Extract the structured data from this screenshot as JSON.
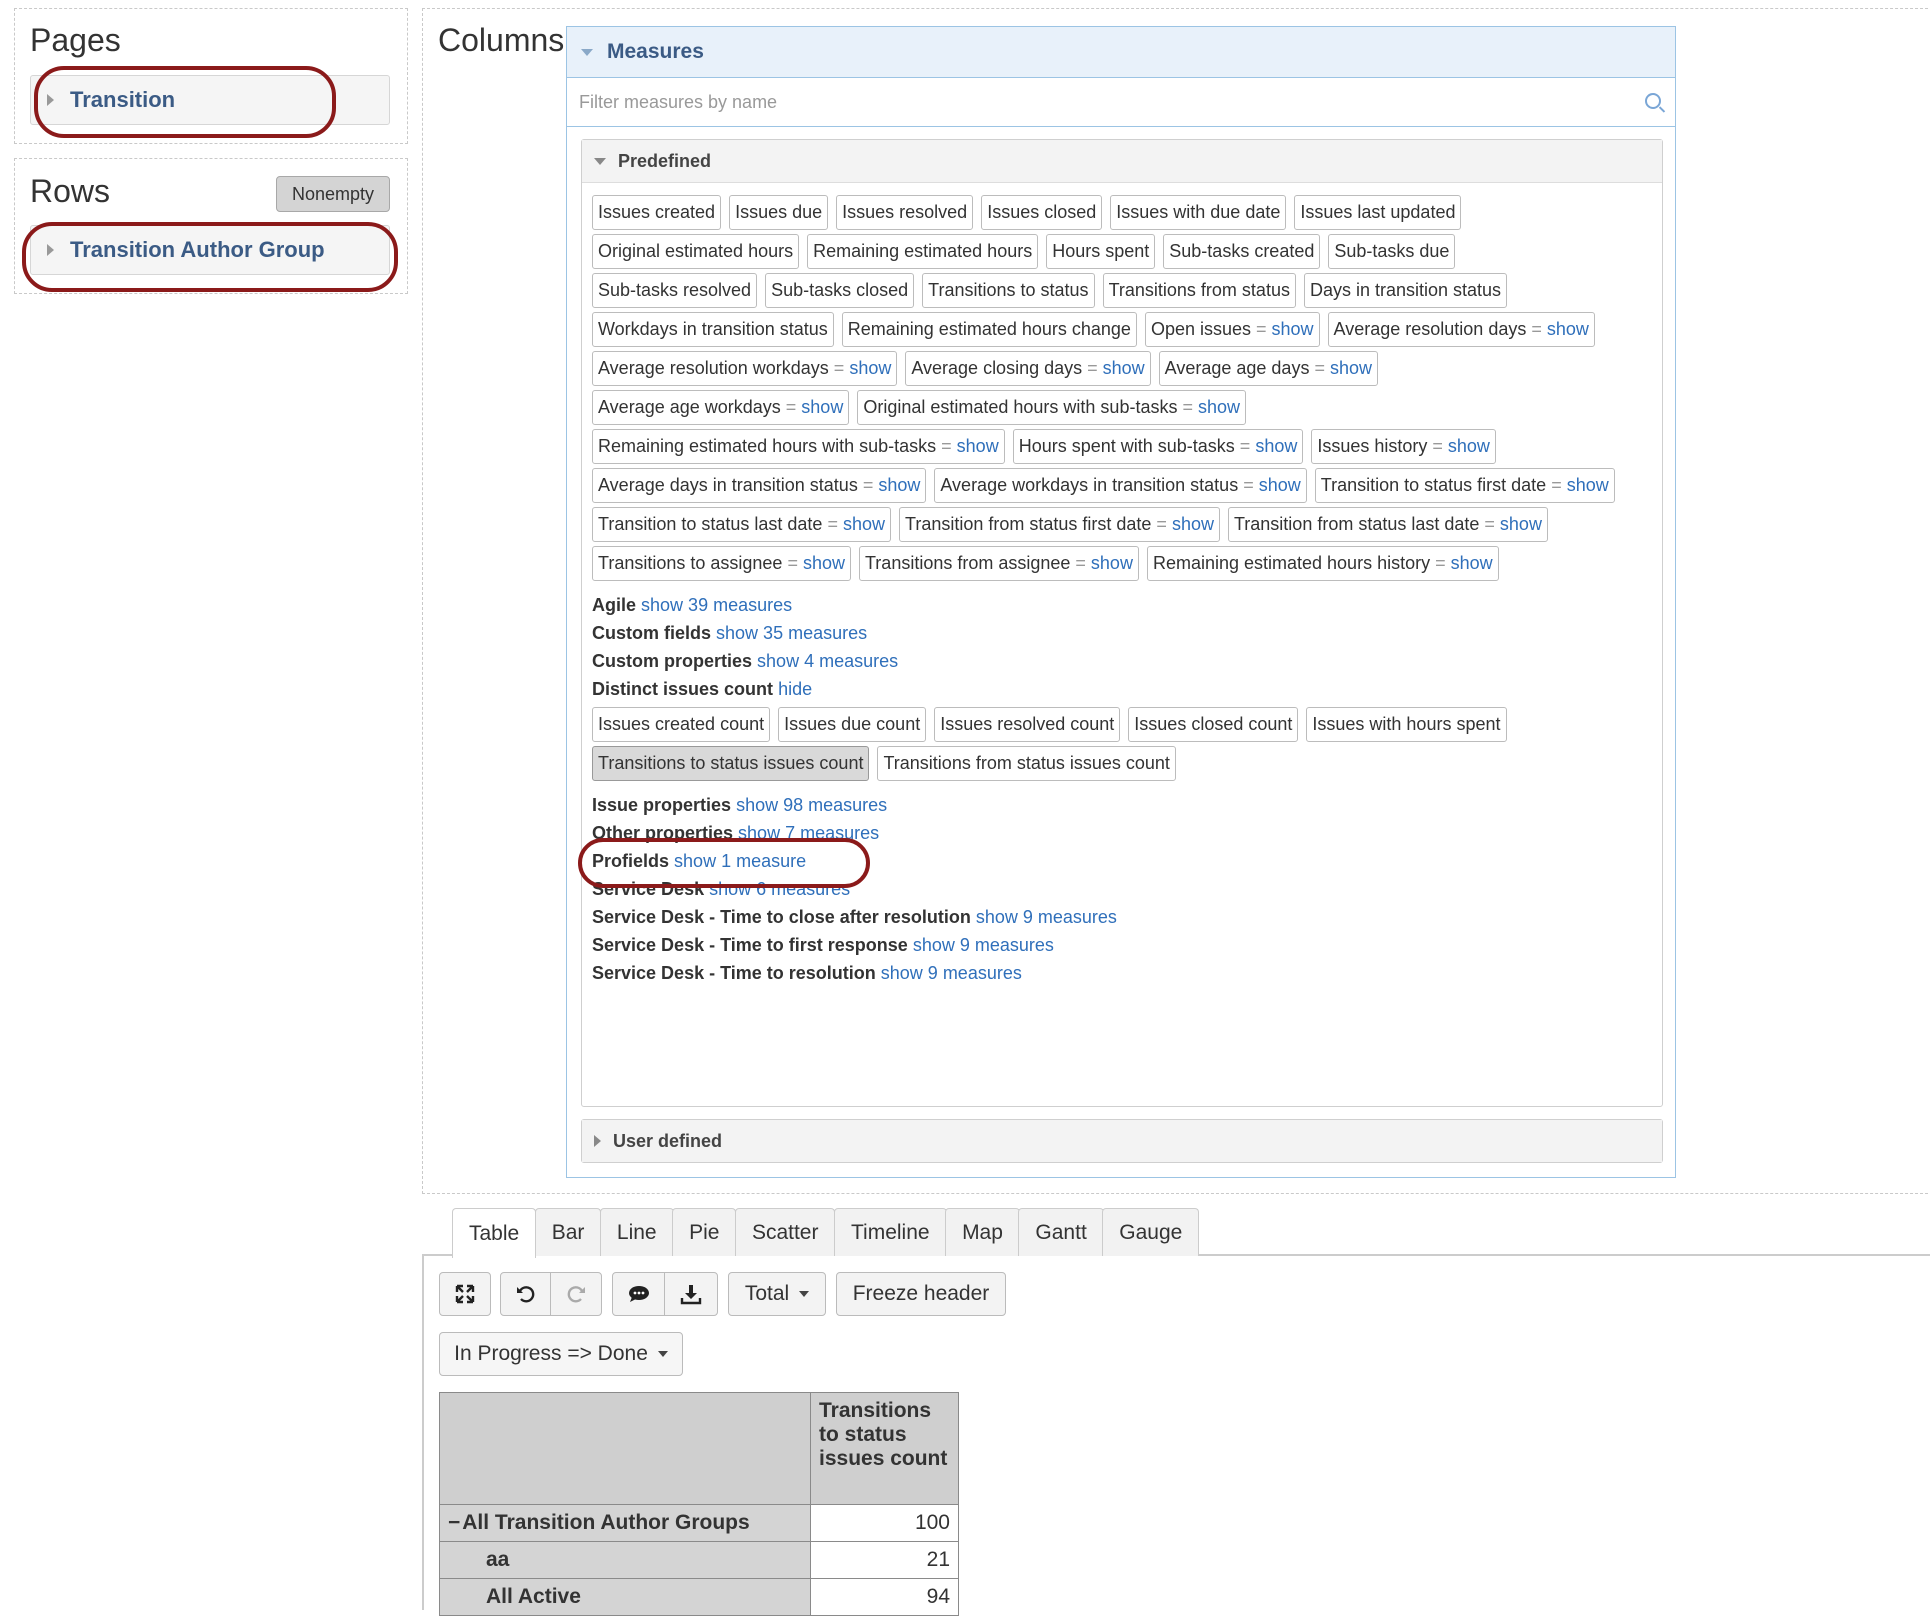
{
  "pages": {
    "title": "Pages",
    "member": "Transition"
  },
  "rows": {
    "title": "Rows",
    "nonempty": "Nonempty",
    "member": "Transition Author Group"
  },
  "columns": {
    "title": "Columns"
  },
  "measures": {
    "title": "Measures",
    "filter_placeholder": "Filter measures by name",
    "predefined": {
      "title": "Predefined",
      "rows": [
        [
          {
            "t": "Issues created"
          },
          {
            "t": "Issues due"
          },
          {
            "t": "Issues resolved"
          },
          {
            "t": "Issues closed"
          },
          {
            "t": "Issues with due date"
          },
          {
            "t": "Issues last updated"
          }
        ],
        [
          {
            "t": "Original estimated hours"
          },
          {
            "t": "Remaining estimated hours"
          },
          {
            "t": "Hours spent"
          },
          {
            "t": "Sub-tasks created"
          },
          {
            "t": "Sub-tasks due"
          }
        ],
        [
          {
            "t": "Sub-tasks resolved"
          },
          {
            "t": "Sub-tasks closed"
          },
          {
            "t": "Transitions to status"
          },
          {
            "t": "Transitions from status"
          },
          {
            "t": "Days in transition status"
          }
        ],
        [
          {
            "t": "Workdays in transition status"
          },
          {
            "t": "Remaining estimated hours change"
          },
          {
            "t": "Open issues",
            "s": "show"
          },
          {
            "t": "Average resolution days",
            "s": "show"
          }
        ],
        [
          {
            "t": "Average resolution workdays",
            "s": "show"
          },
          {
            "t": "Average closing days",
            "s": "show"
          },
          {
            "t": "Average age days",
            "s": "show"
          }
        ],
        [
          {
            "t": "Average age workdays",
            "s": "show"
          },
          {
            "t": "Original estimated hours with sub-tasks",
            "s": "show"
          }
        ],
        [
          {
            "t": "Remaining estimated hours with sub-tasks",
            "s": "show"
          },
          {
            "t": "Hours spent with sub-tasks",
            "s": "show"
          },
          {
            "t": "Issues history",
            "s": "show"
          }
        ],
        [
          {
            "t": "Average days in transition status",
            "s": "show"
          },
          {
            "t": "Average workdays in transition status",
            "s": "show"
          },
          {
            "t": "Transition to status first date",
            "s": "show"
          }
        ],
        [
          {
            "t": "Transition to status last date",
            "s": "show"
          },
          {
            "t": "Transition from status first date",
            "s": "show"
          },
          {
            "t": "Transition from status last date",
            "s": "show"
          }
        ],
        [
          {
            "t": "Transitions to assignee",
            "s": "show"
          },
          {
            "t": "Transitions from assignee",
            "s": "show"
          },
          {
            "t": "Remaining estimated hours history",
            "s": "show"
          }
        ]
      ],
      "groups_a": [
        {
          "name": "Agile",
          "link": "show 39 measures"
        },
        {
          "name": "Custom fields",
          "link": "show 35 measures"
        },
        {
          "name": "Custom properties",
          "link": "show 4 measures"
        },
        {
          "name": "Distinct issues count",
          "link": "hide"
        }
      ],
      "distinct_rows": [
        [
          {
            "t": "Issues created count"
          },
          {
            "t": "Issues due count"
          },
          {
            "t": "Issues resolved count"
          },
          {
            "t": "Issues closed count"
          },
          {
            "t": "Issues with hours spent"
          }
        ],
        [
          {
            "t": "Transitions to status issues count",
            "sel": true
          },
          {
            "t": "Transitions from status issues count"
          }
        ]
      ],
      "groups_b": [
        {
          "name": "Issue properties",
          "link": "show 98 measures"
        },
        {
          "name": "Other properties",
          "link": "show 7 measures"
        },
        {
          "name": "Profields",
          "link": "show 1 measure"
        },
        {
          "name": "Service Desk",
          "link": "show 6 measures"
        },
        {
          "name": "Service Desk - Time to close after resolution",
          "link": "show 9 measures"
        },
        {
          "name": "Service Desk - Time to first response",
          "link": "show 9 measures"
        },
        {
          "name": "Service Desk - Time to resolution",
          "link": "show 9 measures"
        }
      ]
    },
    "user_defined": "User defined"
  },
  "tabs": [
    "Table",
    "Bar",
    "Line",
    "Pie",
    "Scatter",
    "Timeline",
    "Map",
    "Gantt",
    "Gauge"
  ],
  "active_tab": "Table",
  "toolbar": {
    "total": "Total",
    "freeze": "Freeze header",
    "status_filter": "In Progress => Done"
  },
  "table": {
    "column_header": "Transitions to status issues count",
    "rows": [
      {
        "label": "All Transition Author Groups",
        "value": "100",
        "level": 0
      },
      {
        "label": "aa",
        "value": "21",
        "level": 1
      },
      {
        "label": "All Active",
        "value": "94",
        "level": 1
      }
    ]
  }
}
